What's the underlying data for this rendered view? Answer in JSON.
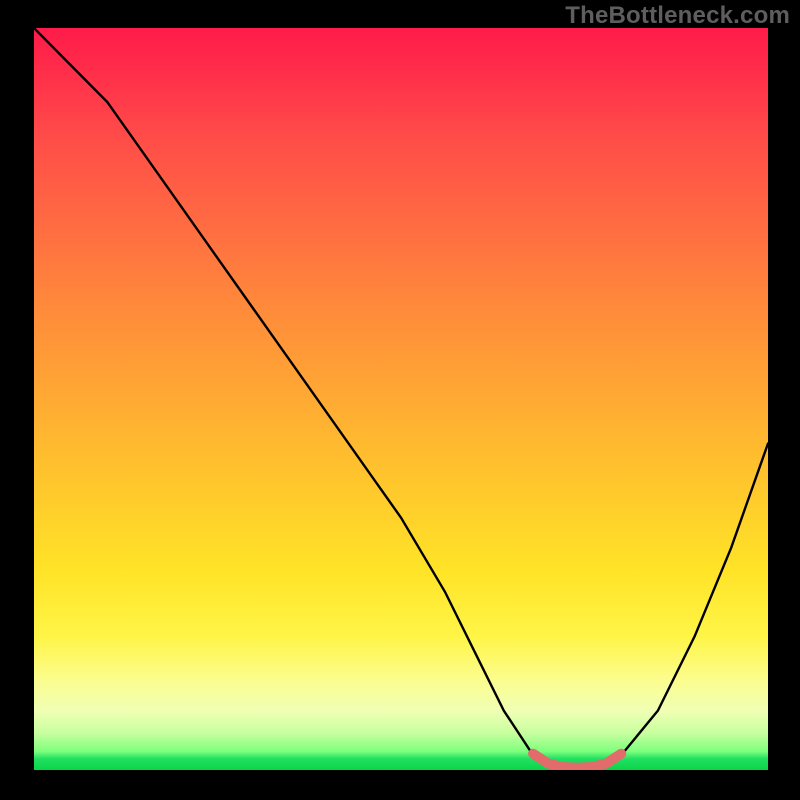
{
  "watermark": "TheBottleneck.com",
  "chart_data": {
    "type": "line",
    "title": "",
    "xlabel": "",
    "ylabel": "",
    "xlim": [
      0,
      100
    ],
    "ylim": [
      0,
      100
    ],
    "grid": false,
    "legend": false,
    "series": [
      {
        "name": "bottleneck-curve",
        "color": "#000000",
        "x": [
          0,
          6,
          10,
          20,
          30,
          40,
          50,
          56,
          60,
          64,
          68,
          72,
          76,
          80,
          85,
          90,
          95,
          100
        ],
        "values": [
          100,
          94,
          90,
          76,
          62,
          48,
          34,
          24,
          16,
          8,
          2,
          0,
          0,
          2,
          8,
          18,
          30,
          44
        ]
      },
      {
        "name": "optimal-band",
        "color": "#e26b6b",
        "x": [
          68,
          70,
          72,
          74,
          76,
          78,
          80
        ],
        "values": [
          2.2,
          0.9,
          0.4,
          0.3,
          0.4,
          0.9,
          2.2
        ]
      }
    ],
    "gradient_stops": [
      {
        "pos": 0.0,
        "color": "#ff1b4a"
      },
      {
        "pos": 0.14,
        "color": "#ff4a49"
      },
      {
        "pos": 0.38,
        "color": "#ff8b3a"
      },
      {
        "pos": 0.62,
        "color": "#ffc82c"
      },
      {
        "pos": 0.82,
        "color": "#fff547"
      },
      {
        "pos": 0.92,
        "color": "#f0ffb4"
      },
      {
        "pos": 0.975,
        "color": "#7dff7d"
      },
      {
        "pos": 1.0,
        "color": "#0cd54a"
      }
    ]
  }
}
